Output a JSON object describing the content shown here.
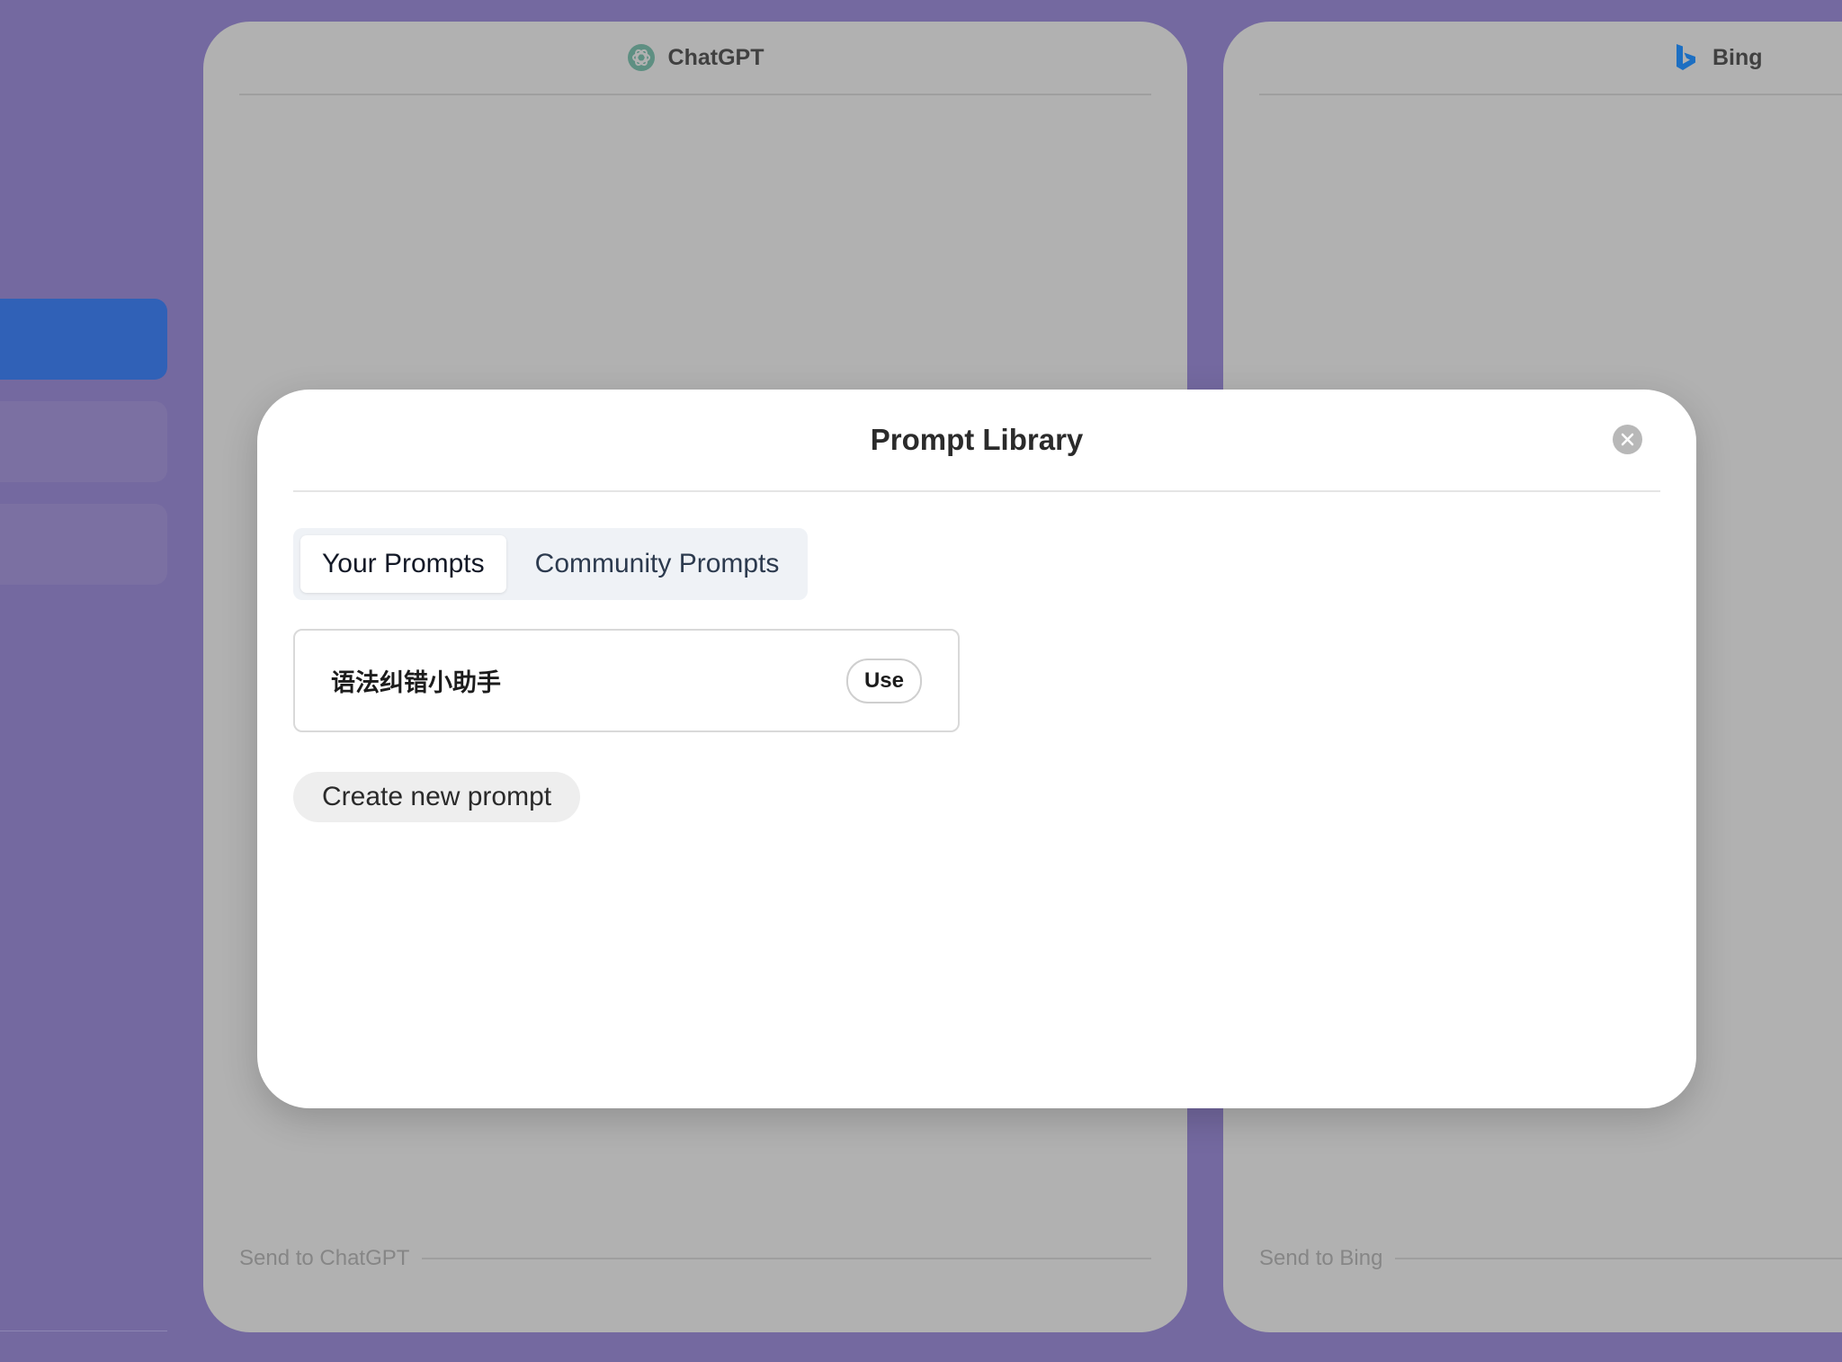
{
  "panels": {
    "chatgpt": {
      "title": "ChatGPT",
      "send_label": "Send to ChatGPT"
    },
    "bing": {
      "title": "Bing",
      "send_label": "Send to Bing"
    }
  },
  "modal": {
    "title": "Prompt Library",
    "tabs": [
      {
        "label": "Your Prompts",
        "selected": true
      },
      {
        "label": "Community Prompts",
        "selected": false
      }
    ],
    "prompts": [
      {
        "title": "语法纠错小助手",
        "action_label": "Use"
      }
    ],
    "create_label": "Create new prompt"
  },
  "icons": {
    "chatgpt": "chatgpt-logo-icon",
    "bing": "bing-logo-icon",
    "close": "close-icon"
  },
  "colors": {
    "background": "#7469a0",
    "sidebar_active": "#3061b7",
    "panel_dimmed": "#b1b1b1",
    "chatgpt_logo": "#5e8f82",
    "bing_logo": "#1d6fc2"
  }
}
